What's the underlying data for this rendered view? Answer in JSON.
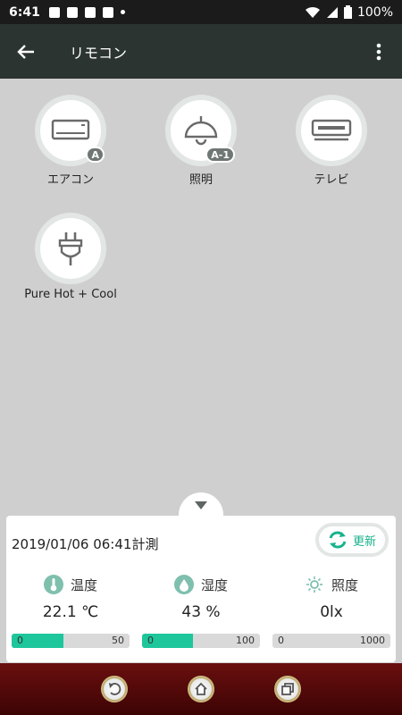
{
  "status_bar": {
    "time": "6:41",
    "battery": "100%"
  },
  "app_bar": {
    "title": "リモコン"
  },
  "devices": [
    {
      "label": "エアコン",
      "badge": "A"
    },
    {
      "label": "照明",
      "badge": "A-1"
    },
    {
      "label": "テレビ",
      "badge": ""
    },
    {
      "label": "Pure Hot + Cool",
      "badge": ""
    }
  ],
  "panel": {
    "measured_at": "2019/01/06 06:41計測",
    "refresh_label": "更新",
    "accent_color": "#17b28c",
    "sensors": [
      {
        "name": "温度",
        "value": "22.1 ℃",
        "bar_min": "0",
        "bar_max": "50",
        "fill_fraction": 0.44
      },
      {
        "name": "湿度",
        "value": "43 %",
        "bar_min": "0",
        "bar_max": "100",
        "fill_fraction": 0.43
      },
      {
        "name": "照度",
        "value": "0lx",
        "bar_min": "0",
        "bar_max": "1000",
        "fill_fraction": 0.0
      }
    ]
  },
  "icons": {
    "back": "arrow-left-icon",
    "more": "more-vertical-icon",
    "aircon": "air-conditioner-icon",
    "light": "ceiling-lamp-icon",
    "tv": "tv-icon",
    "plug": "plug-icon",
    "refresh": "refresh-icon",
    "thermometer": "thermometer-icon",
    "humidity": "droplet-icon",
    "illuminance": "sun-icon"
  }
}
